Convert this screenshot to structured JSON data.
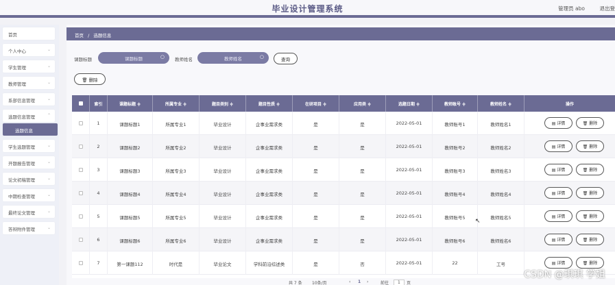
{
  "header": {
    "app_title": "毕业设计管理系统",
    "user": "管理员 abo",
    "logout": "退出登"
  },
  "sidebar": {
    "items": [
      {
        "label": "首页"
      },
      {
        "label": "个人中心"
      },
      {
        "label": "学生管理"
      },
      {
        "label": "教师管理"
      },
      {
        "label": "系部信息管理"
      },
      {
        "label": "选题信息管理"
      },
      {
        "label": "选题信息"
      },
      {
        "label": "学生选题管理"
      },
      {
        "label": "开题报告管理"
      },
      {
        "label": "论文初稿管理"
      },
      {
        "label": "中期检查管理"
      },
      {
        "label": "最终论文管理"
      },
      {
        "label": "答辩附件管理"
      }
    ]
  },
  "breadcrumb": {
    "home": "首页",
    "sep": "/",
    "current": "选题信息"
  },
  "search": {
    "topic_label": "课题标题",
    "topic_placeholder": "课题标题",
    "teacher_label": "教师姓名",
    "teacher_placeholder": "教师姓名",
    "query_label": "查询"
  },
  "toolbar": {
    "delete_label": "删除"
  },
  "table": {
    "columns": [
      "索引",
      "课题标题 ≑",
      "所属专业 ≑",
      "题目类别 ≑",
      "题目性质 ≑",
      "在研项目 ≑",
      "应用类 ≑",
      "选题日期 ≑",
      "教师账号 ≑",
      "教师姓名 ≑",
      "操作"
    ],
    "rows": [
      [
        "1",
        "课题标题1",
        "所属专业1",
        "毕业设计",
        "企事业需求类",
        "是",
        "是",
        "2022-05-01",
        "教师账号1",
        "教师姓名1"
      ],
      [
        "2",
        "课题标题2",
        "所属专业2",
        "毕业设计",
        "企事业需求类",
        "是",
        "是",
        "2022-05-01",
        "教师账号2",
        "教师姓名2"
      ],
      [
        "3",
        "课题标题3",
        "所属专业3",
        "毕业设计",
        "企事业需求类",
        "是",
        "是",
        "2022-05-01",
        "教师账号3",
        "教师姓名3"
      ],
      [
        "4",
        "课题标题4",
        "所属专业4",
        "毕业设计",
        "企事业需求类",
        "是",
        "是",
        "2022-05-01",
        "教师账号4",
        "教师姓名4"
      ],
      [
        "5",
        "课题标题5",
        "所属专业5",
        "毕业设计",
        "企事业需求类",
        "是",
        "是",
        "2022-05-01",
        "教师账号5",
        "教师姓名5"
      ],
      [
        "6",
        "课题标题6",
        "所属专业6",
        "毕业设计",
        "企事业需求类",
        "是",
        "是",
        "2022-05-01",
        "教师账号6",
        "教师姓名6"
      ],
      [
        "7",
        "第一课题112",
        "时代是",
        "毕业论文",
        "学科前沿综述类",
        "是",
        "否",
        "2022-05-01",
        "22",
        "工号"
      ]
    ],
    "detail_label": "详情",
    "row_delete_label": "删除"
  },
  "pager": {
    "total": "共 7 条",
    "page_size": "10条/页",
    "prev": "‹",
    "current_page": "1",
    "next": "›",
    "goto": "前往",
    "goto_value": "1",
    "page_unit": "页"
  },
  "watermark": "CSDN @琪琪 学姐",
  "colors": {
    "accent": "#6b6b94",
    "search_fill": "#7b7ba4"
  }
}
